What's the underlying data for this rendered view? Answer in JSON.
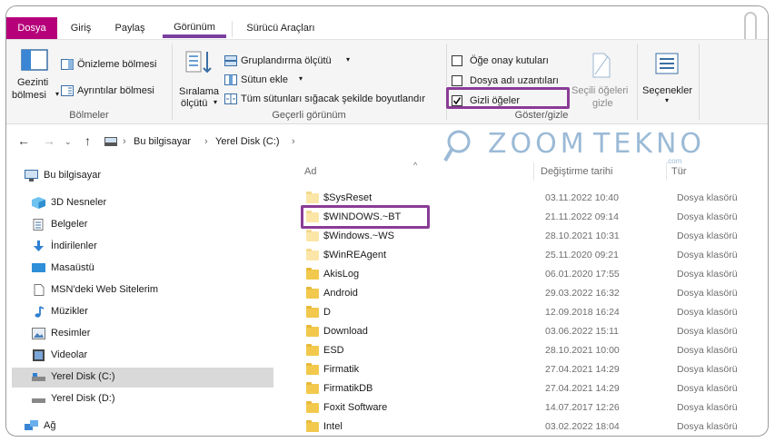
{
  "tabs": {
    "file": "Dosya",
    "home": "Giriş",
    "share": "Paylaş",
    "view": "Görünüm",
    "drive_tools": "Sürücü Araçları"
  },
  "ribbon": {
    "panes": {
      "nav_pane": [
        "Gezinti",
        "bölmesi"
      ],
      "preview": "Önizleme bölmesi",
      "details": "Ayrıntılar bölmesi",
      "label": "Bölmeler"
    },
    "current_view": {
      "sort": [
        "Sıralama",
        "ölçütü"
      ],
      "group_by": "Gruplandırma ölçütü",
      "add_column": "Sütun ekle",
      "fit_columns": "Tüm sütunları sığacak şekilde boyutlandır",
      "label": "Geçerli görünüm"
    },
    "show_hide": {
      "item_checkboxes": "Öğe onay kutuları",
      "file_extensions": "Dosya adı uzantıları",
      "hidden_items": "Gizli öğeler",
      "hide_selected": [
        "Seçili öğeleri",
        "gizle"
      ],
      "label": "Göster/gizle"
    },
    "options": "Seçenekler"
  },
  "address": {
    "this_pc": "Bu bilgisayar",
    "drive": "Yerel Disk (C:)"
  },
  "watermark": {
    "text_a": "ZOOM",
    "text_b": "TEKNO",
    "sub": ".com"
  },
  "tree": [
    {
      "label": "Bu bilgisayar",
      "icon": "computer-icon"
    },
    {
      "label": "3D Nesneler",
      "icon": "cube-icon"
    },
    {
      "label": "Belgeler",
      "icon": "documents-icon"
    },
    {
      "label": "İndirilenler",
      "icon": "download-icon"
    },
    {
      "label": "Masaüstü",
      "icon": "desktop-icon"
    },
    {
      "label": "MSN'deki Web Sitelerim",
      "icon": "page-icon"
    },
    {
      "label": "Müzikler",
      "icon": "music-icon"
    },
    {
      "label": "Resimler",
      "icon": "pictures-icon"
    },
    {
      "label": "Videolar",
      "icon": "video-icon"
    },
    {
      "label": "Yerel Disk (C:)",
      "icon": "drive-icon"
    },
    {
      "label": "Yerel Disk (D:)",
      "icon": "drive-icon"
    },
    {
      "label": "Ağ",
      "icon": "network-icon"
    }
  ],
  "columns": {
    "name": "Ad",
    "modified": "Değiştirme tarihi",
    "type": "Tür"
  },
  "files": [
    {
      "name": "$SysReset",
      "date": "03.11.2022 10:40",
      "type": "Dosya klasörü",
      "hidden": true
    },
    {
      "name": "$WINDOWS.~BT",
      "date": "21.11.2022 09:14",
      "type": "Dosya klasörü",
      "hidden": true
    },
    {
      "name": "$Windows.~WS",
      "date": "28.10.2021 10:31",
      "type": "Dosya klasörü",
      "hidden": true
    },
    {
      "name": "$WinREAgent",
      "date": "25.11.2020 09:21",
      "type": "Dosya klasörü",
      "hidden": true
    },
    {
      "name": "AkisLog",
      "date": "06.01.2020 17:55",
      "type": "Dosya klasörü",
      "hidden": false
    },
    {
      "name": "Android",
      "date": "29.03.2022 16:32",
      "type": "Dosya klasörü",
      "hidden": false
    },
    {
      "name": "D",
      "date": "12.09.2018 16:24",
      "type": "Dosya klasörü",
      "hidden": false
    },
    {
      "name": "Download",
      "date": "03.06.2022 15:11",
      "type": "Dosya klasörü",
      "hidden": false
    },
    {
      "name": "ESD",
      "date": "28.10.2021 10:00",
      "type": "Dosya klasörü",
      "hidden": false
    },
    {
      "name": "Firmatik",
      "date": "27.04.2021 14:29",
      "type": "Dosya klasörü",
      "hidden": false
    },
    {
      "name": "FirmatikDB",
      "date": "27.04.2021 14:29",
      "type": "Dosya klasörü",
      "hidden": false
    },
    {
      "name": "Foxit Software",
      "date": "14.07.2017 12:26",
      "type": "Dosya klasörü",
      "hidden": false
    },
    {
      "name": "Intel",
      "date": "03.02.2022 18:04",
      "type": "Dosya klasörü",
      "hidden": false
    }
  ],
  "colors": {
    "file_tab": "#b5007a",
    "highlight": "#8a3c96",
    "folder": "#f2c94c",
    "watermark": "#9bbad6"
  }
}
